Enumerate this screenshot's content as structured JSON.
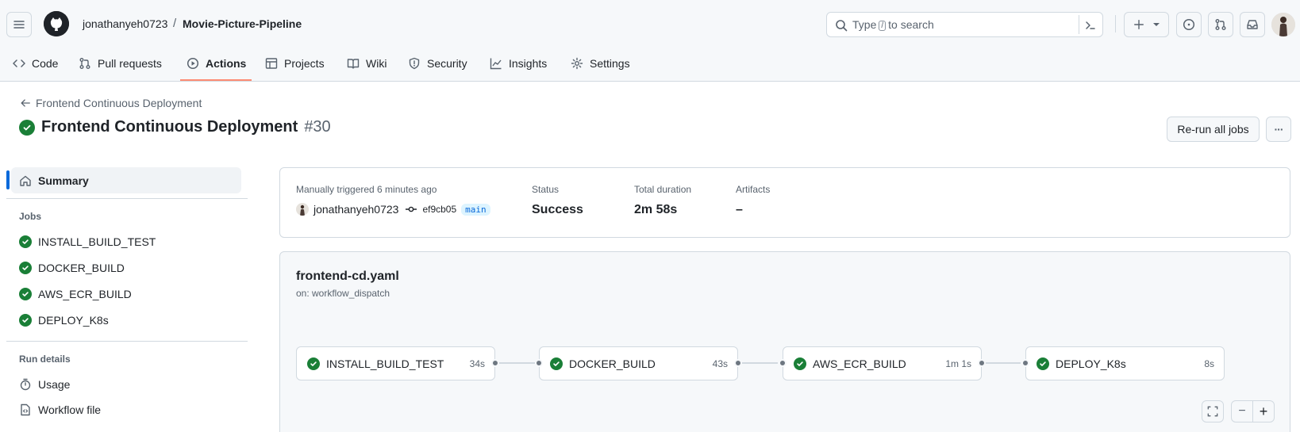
{
  "header": {
    "owner": "jonathanyeh0723",
    "separator": "/",
    "repo": "Movie-Picture-Pipeline",
    "search_prefix": "Type",
    "search_key": "/",
    "search_suffix": "to search"
  },
  "tabs": [
    {
      "label": "Code",
      "icon": "code-icon"
    },
    {
      "label": "Pull requests",
      "icon": "git-pull-request-icon"
    },
    {
      "label": "Actions",
      "icon": "play-icon",
      "active": true
    },
    {
      "label": "Projects",
      "icon": "table-icon"
    },
    {
      "label": "Wiki",
      "icon": "book-icon"
    },
    {
      "label": "Security",
      "icon": "shield-icon"
    },
    {
      "label": "Insights",
      "icon": "graph-icon"
    },
    {
      "label": "Settings",
      "icon": "gear-icon"
    }
  ],
  "run": {
    "back_label": "Frontend Continuous Deployment",
    "title": "Frontend Continuous Deployment",
    "number": "#30",
    "rerun_label": "Re-run all jobs",
    "more_label": "···"
  },
  "sidebar": {
    "summary_label": "Summary",
    "jobs_heading": "Jobs",
    "jobs": [
      "INSTALL_BUILD_TEST",
      "DOCKER_BUILD",
      "AWS_ECR_BUILD",
      "DEPLOY_K8s"
    ],
    "run_details_heading": "Run details",
    "usage_label": "Usage",
    "workflow_file_label": "Workflow file"
  },
  "summary": {
    "trigger_text": "Manually triggered 6 minutes ago",
    "actor": "jonathanyeh0723",
    "commit": "ef9cb05",
    "branch": "main",
    "status_label": "Status",
    "status_value": "Success",
    "duration_label": "Total duration",
    "duration_value": "2m 58s",
    "artifacts_label": "Artifacts",
    "artifacts_value": "–"
  },
  "workflow": {
    "file": "frontend-cd.yaml",
    "trigger": "on: workflow_dispatch",
    "jobs": [
      {
        "name": "INSTALL_BUILD_TEST",
        "duration": "34s"
      },
      {
        "name": "DOCKER_BUILD",
        "duration": "43s"
      },
      {
        "name": "AWS_ECR_BUILD",
        "duration": "1m 1s"
      },
      {
        "name": "DEPLOY_K8s",
        "duration": "8s"
      }
    ],
    "zoom_out_label": "−",
    "zoom_in_label": "+"
  },
  "colors": {
    "success": "#1a7f37",
    "accent": "#0969da",
    "active_tab_underline": "#fd8c73"
  }
}
